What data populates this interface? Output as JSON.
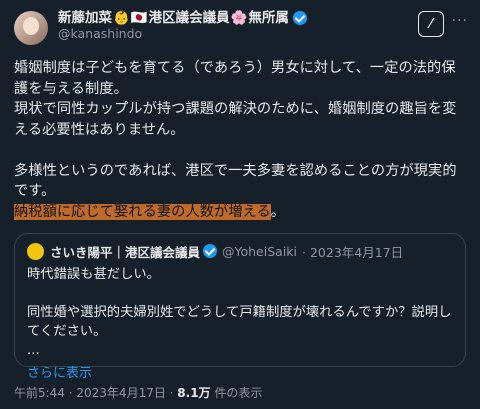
{
  "author": {
    "name_text": "新藤加菜",
    "name_suffix": "港区議会議員",
    "name_suffix2": "無所属",
    "handle": "@kanashindo"
  },
  "tweet": {
    "line1": "婚姻制度は子どもを育てる（であろう）男女に対して、一定の法的保護を与える制度。",
    "line2": "現状で同性カップルが持つ課題の解決のために、婚姻制度の趣旨を変える必要性はありません。",
    "line3": "多様性というのであれば、港区で一夫多妻を認めることの方が現実的です。",
    "highlight": "納税額に応じて娶れる妻の人数が増える",
    "highlight_end": "。"
  },
  "quote": {
    "name": "さいき陽平｜港区議会議員",
    "handle": "@YoheiSaiki",
    "date": "· 2023年4月17日",
    "line1": "時代錯誤も甚だしい。",
    "line2": "同性婚や選択的夫婦別姓でどうして戸籍制度が壊れるんですか？説明してください。",
    "ellipsis": "...",
    "show_more": "さらに表示"
  },
  "meta": {
    "time": "午前5:44 · 2023年4月17日 · ",
    "views": "8.1万",
    "views_label": " 件の表示"
  },
  "icons": {
    "grok": "grok-icon",
    "more": "more-icon"
  }
}
